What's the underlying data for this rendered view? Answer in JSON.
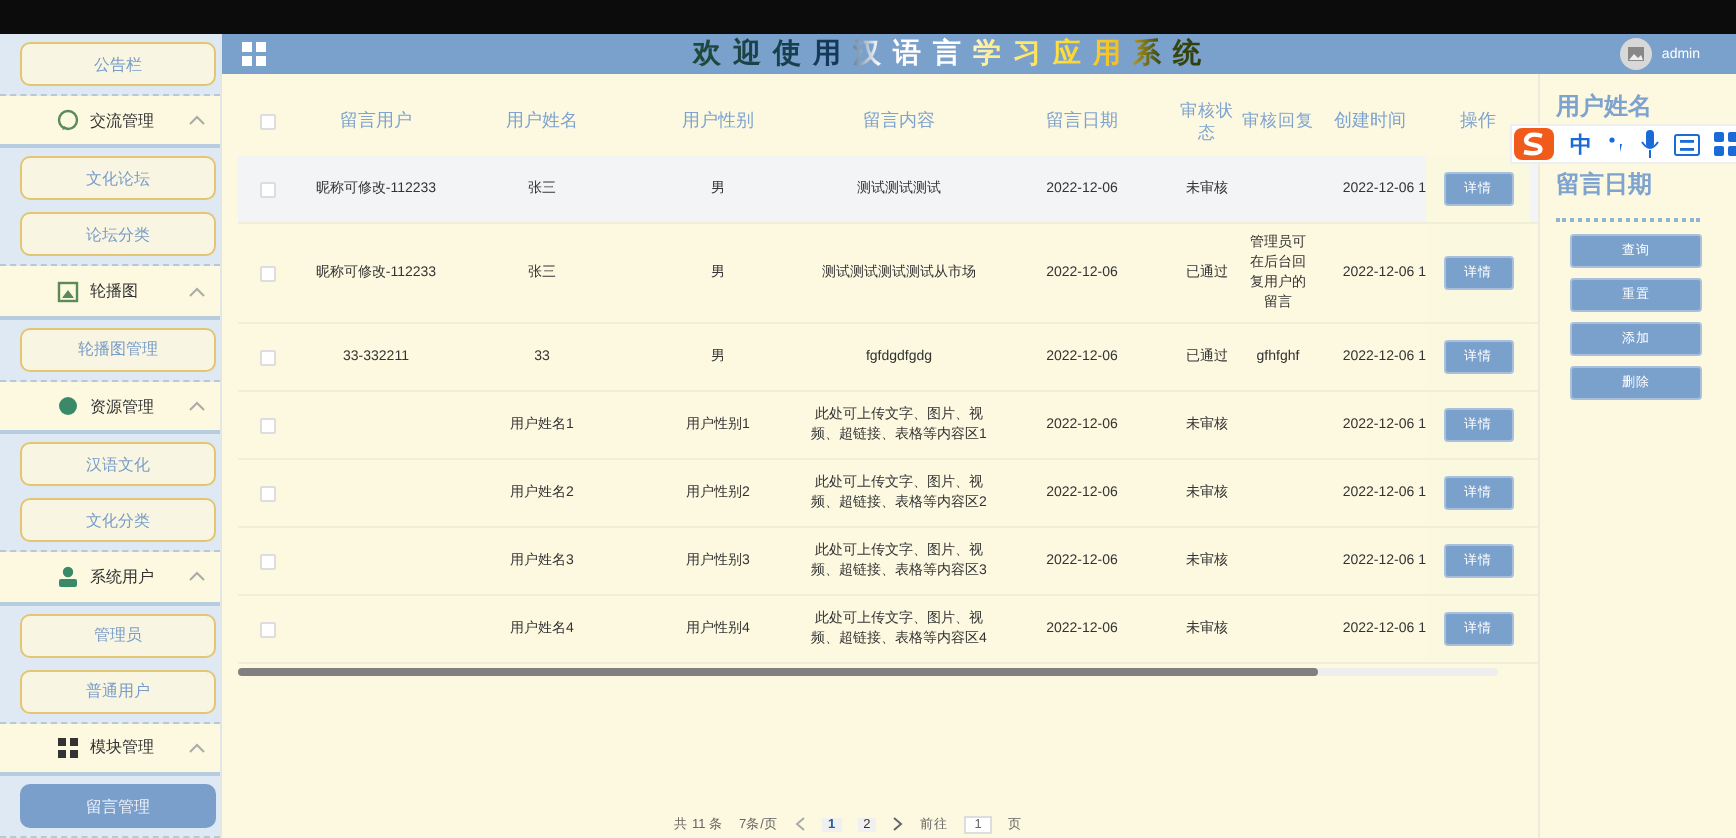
{
  "header": {
    "title": "欢迎使用汉语言学习应用系统",
    "user": "admin"
  },
  "sidebar": {
    "items": [
      {
        "kind": "link",
        "label": "公告栏",
        "selected": false
      },
      {
        "kind": "group",
        "label": "交流管理",
        "expanded": true,
        "children": [
          {
            "label": "文化论坛",
            "selected": false
          },
          {
            "label": "论坛分类",
            "selected": false
          }
        ]
      },
      {
        "kind": "group",
        "label": "轮播图",
        "expanded": true,
        "children": [
          {
            "label": "轮播图管理",
            "selected": false
          }
        ]
      },
      {
        "kind": "group",
        "label": "资源管理",
        "expanded": true,
        "children": [
          {
            "label": "汉语文化",
            "selected": false
          },
          {
            "label": "文化分类",
            "selected": false
          }
        ]
      },
      {
        "kind": "group",
        "label": "系统用户",
        "expanded": true,
        "children": [
          {
            "label": "管理员",
            "selected": false
          },
          {
            "label": "普通用户",
            "selected": false
          }
        ]
      },
      {
        "kind": "group",
        "label": "模块管理",
        "expanded": true,
        "children": [
          {
            "label": "留言管理",
            "selected": true
          }
        ]
      }
    ]
  },
  "table": {
    "header_checkbox": {
      "checked": false
    },
    "columns": [
      "留言用户",
      "用户姓名",
      "用户性别",
      "留言内容",
      "留言日期",
      "审核状态",
      "审核回复",
      "创建时间",
      "操作"
    ],
    "rows": [
      {
        "hovered": true,
        "checked": false,
        "cells": [
          "昵称可修改-112233",
          "张三",
          "男",
          "测试测试测试",
          "2022-12-06",
          "未审核",
          "",
          "2022-12-06 1"
        ],
        "action": "详情"
      },
      {
        "hovered": false,
        "checked": false,
        "cells": [
          "昵称可修改-112233",
          "张三",
          "男",
          "测试测试测试测试从市场",
          "2022-12-06",
          "已通过",
          "管理员可在后台回复用户的留言",
          "2022-12-06 1"
        ],
        "action": "详情"
      },
      {
        "hovered": false,
        "checked": false,
        "cells": [
          "33-332211",
          "33",
          "男",
          "fgfdgdfgdg",
          "2022-12-06",
          "已通过",
          "gfhfghf",
          "2022-12-06 1"
        ],
        "action": "详情"
      },
      {
        "hovered": false,
        "checked": false,
        "cells": [
          "",
          "用户姓名1",
          "用户性别1",
          "此处可上传文字、图片、视频、超链接、表格等内容区1",
          "2022-12-06",
          "未审核",
          "",
          "2022-12-06 1"
        ],
        "action": "详情"
      },
      {
        "hovered": false,
        "checked": false,
        "cells": [
          "",
          "用户姓名2",
          "用户性别2",
          "此处可上传文字、图片、视频、超链接、表格等内容区2",
          "2022-12-06",
          "未审核",
          "",
          "2022-12-06 1"
        ],
        "action": "详情"
      },
      {
        "hovered": false,
        "checked": false,
        "cells": [
          "",
          "用户姓名3",
          "用户性别3",
          "此处可上传文字、图片、视频、超链接、表格等内容区3",
          "2022-12-06",
          "未审核",
          "",
          "2022-12-06 1"
        ],
        "action": "详情"
      },
      {
        "hovered": false,
        "checked": false,
        "cells": [
          "",
          "用户姓名4",
          "用户性别4",
          "此处可上传文字、图片、视频、超链接、表格等内容区4",
          "2022-12-06",
          "未审核",
          "",
          "2022-12-06 1"
        ],
        "action": "详情"
      }
    ]
  },
  "search_panel": {
    "labels": [
      "用户姓名",
      "留言日期"
    ],
    "buttons": [
      "查询",
      "重置",
      "添加",
      "删除"
    ]
  },
  "pagination": {
    "total": "共 11 条",
    "page_size": "7条/页",
    "pages": [
      {
        "label": "1",
        "selected": true
      },
      {
        "label": "2",
        "selected": false
      }
    ],
    "goto_label": "前往",
    "goto_value": "1",
    "goto_suffix": "页"
  },
  "ime_toolbar": {
    "label": "中"
  }
}
